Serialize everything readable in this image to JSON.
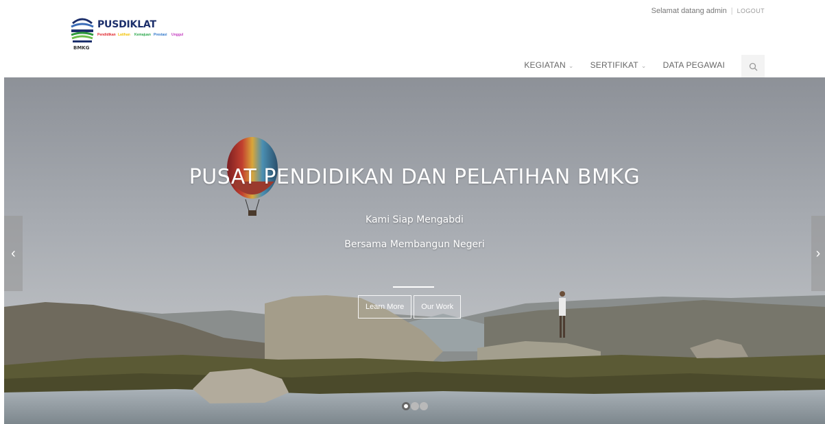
{
  "brand": {
    "name": "PUSDIKLAT",
    "sub": "BMKG",
    "tagline_words": [
      "Pendidikan",
      "Latihan",
      "Kemajuan",
      "Prestasi",
      "Unggul"
    ]
  },
  "header": {
    "welcome": "Selamat datang admin",
    "separator": "|",
    "logout": "LOGOUT"
  },
  "nav": {
    "items": [
      {
        "label": "KEGIATAN",
        "has_dropdown": true
      },
      {
        "label": "SERTIFIKAT",
        "has_dropdown": true
      },
      {
        "label": "DATA PEGAWAI",
        "has_dropdown": false
      }
    ],
    "caret": "⌄",
    "search_icon": "search-icon"
  },
  "hero": {
    "title": "PUSAT PENDIDIKAN DAN PELATIHAN BMKG",
    "line1": "Kami Siap Mengabdi",
    "line2": "Bersama Membangun Negeri",
    "buttons": [
      "Learn More",
      "Our Work"
    ],
    "prev": "‹",
    "next": "›",
    "slide_count": 3,
    "active_slide": 1
  },
  "colors": {
    "brand_navy": "#1c2f6b",
    "nav_text": "#666666",
    "hero_text": "#ffffff"
  }
}
